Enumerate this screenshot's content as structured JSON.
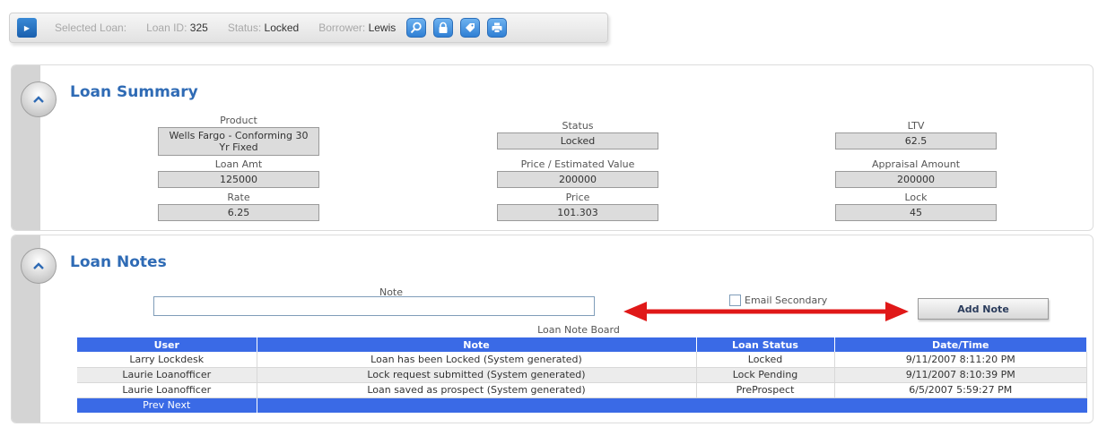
{
  "topbar": {
    "selected_label": "Selected Loan:",
    "loan_id_label": "Loan ID:",
    "loan_id": "325",
    "status_label": "Status:",
    "status": "Locked",
    "borrower_label": "Borrower:",
    "borrower": "Lewis",
    "icons": [
      "search-icon",
      "lock-icon",
      "tag-icon",
      "print-icon"
    ]
  },
  "summary": {
    "title": "Loan Summary",
    "fields": {
      "product": {
        "label": "Product",
        "value": "Wells Fargo - Conforming 30 Yr Fixed"
      },
      "status": {
        "label": "Status",
        "value": "Locked"
      },
      "ltv": {
        "label": "LTV",
        "value": "62.5"
      },
      "loan_amt": {
        "label": "Loan Amt",
        "value": "125000"
      },
      "price_est": {
        "label": "Price / Estimated Value",
        "value": "200000"
      },
      "appraisal": {
        "label": "Appraisal Amount",
        "value": "200000"
      },
      "rate": {
        "label": "Rate",
        "value": "6.25"
      },
      "price": {
        "label": "Price",
        "value": "101.303"
      },
      "lock": {
        "label": "Lock",
        "value": "45"
      }
    }
  },
  "notes": {
    "title": "Loan Notes",
    "note_label": "Note",
    "note_value": "",
    "email_secondary_label": "Email Secondary",
    "add_note_label": "Add Note",
    "board_label": "Loan Note Board",
    "columns": [
      "User",
      "Note",
      "Loan Status",
      "Date/Time"
    ],
    "rows": [
      [
        "Larry Lockdesk",
        "Loan has been Locked (System generated)",
        "Locked",
        "9/11/2007 8:11:20 PM"
      ],
      [
        "Laurie Loanofficer",
        "Lock request submitted (System generated)",
        "Lock Pending",
        "9/11/2007 8:10:39 PM"
      ],
      [
        "Laurie Loanofficer",
        "Loan saved as prospect (System generated)",
        "PreProspect",
        "6/5/2007 5:59:27 PM"
      ]
    ],
    "prev_label": "Prev",
    "next_label": "Next"
  },
  "colors": {
    "title_blue": "#2f6bb5",
    "header_blue": "#3a6ae6",
    "arrow_red": "#e01818"
  }
}
